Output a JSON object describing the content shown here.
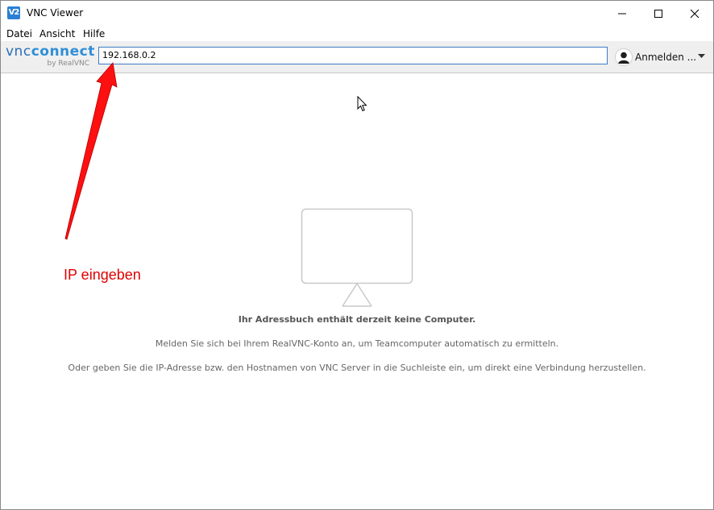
{
  "window": {
    "title": "VNC Viewer",
    "icon_text": "V2"
  },
  "menu": {
    "items": [
      {
        "label": "Datei"
      },
      {
        "label": "Ansicht"
      },
      {
        "label": "Hilfe"
      }
    ]
  },
  "toolbar": {
    "logo_main_vnc": "vnc",
    "logo_main_connect": "connect",
    "logo_sub": "by RealVNC",
    "address_value": "192.168.0.2",
    "signin_label": "Anmelden ..."
  },
  "empty_state": {
    "title": "Ihr Adressbuch enthält derzeit keine Computer.",
    "line1": "Melden Sie sich bei Ihrem RealVNC-Konto an, um Teamcomputer automatisch zu ermitteln.",
    "line2": "Oder geben Sie die IP-Adresse bzw. den Hostnamen von VNC Server in die Suchleiste ein, um direkt eine Verbindung herzustellen."
  },
  "annotation": {
    "text": "IP eingeben",
    "color": "#e00000"
  },
  "colors": {
    "accent": "#2f8fd8",
    "input_border": "#3b7cc4",
    "toolbar_bg": "#efefef"
  },
  "icons": [
    "app-icon",
    "minimize-icon",
    "maximize-icon",
    "close-icon",
    "avatar-icon",
    "chevron-down-icon",
    "monitor-icon",
    "cursor-icon",
    "arrow-annotation"
  ]
}
